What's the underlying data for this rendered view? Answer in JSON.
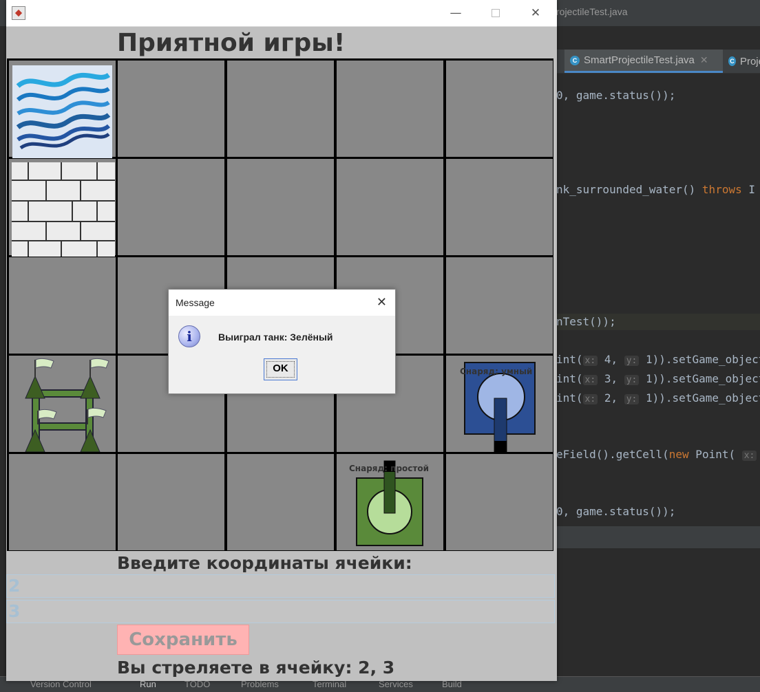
{
  "ide": {
    "window_title": "rojectileTest.java",
    "tabs": [
      {
        "label": "SmartProjectileTest.java",
        "active": true,
        "icon": "class-icon"
      },
      {
        "label": "Proje",
        "active": false,
        "icon": "class-icon"
      }
    ],
    "code": [
      {
        "parts": [
          {
            "t": "0, game.status());",
            "c": "plain"
          }
        ]
      },
      {
        "parts": [
          {
            "t": "nk_surrounded_water() ",
            "c": "plain"
          },
          {
            "t": "throws",
            "c": "kw"
          },
          {
            "t": " I",
            "c": "plain"
          }
        ]
      },
      {
        "parts": [
          {
            "t": "nTest());",
            "c": "plain"
          }
        ]
      },
      {
        "parts": [
          {
            "t": "int(",
            "c": "plain"
          },
          {
            "t": "x:",
            "c": "hint"
          },
          {
            "t": " 4, ",
            "c": "plain"
          },
          {
            "t": "y:",
            "c": "hint"
          },
          {
            "t": " 1)).setGame_object",
            "c": "plain"
          }
        ]
      },
      {
        "parts": [
          {
            "t": "int(",
            "c": "plain"
          },
          {
            "t": "x:",
            "c": "hint"
          },
          {
            "t": " 3, ",
            "c": "plain"
          },
          {
            "t": "y:",
            "c": "hint"
          },
          {
            "t": " 1)).setGame_object",
            "c": "plain"
          }
        ]
      },
      {
        "parts": [
          {
            "t": "int(",
            "c": "plain"
          },
          {
            "t": "x:",
            "c": "hint"
          },
          {
            "t": " 2, ",
            "c": "plain"
          },
          {
            "t": "y:",
            "c": "hint"
          },
          {
            "t": " 1)).setGame_object",
            "c": "plain"
          }
        ]
      },
      {
        "parts": [
          {
            "t": "eField().getCell(",
            "c": "plain"
          },
          {
            "t": "new",
            "c": "kw"
          },
          {
            "t": " Point( ",
            "c": "plain"
          },
          {
            "t": "x:",
            "c": "hint"
          }
        ]
      },
      {
        "parts": [
          {
            "t": "0, game.status());",
            "c": "plain"
          }
        ]
      }
    ],
    "status_bar": [
      "Version Control",
      "Run",
      "TODO",
      "Problems",
      "Terminal",
      "Services",
      "Build"
    ]
  },
  "game": {
    "title": "Приятной игры!",
    "window_controls": [
      "minimize",
      "maximize",
      "close"
    ],
    "cells": {
      "water": {
        "col": 0,
        "row": 0,
        "type": "water"
      },
      "wall": {
        "col": 0,
        "row": 1,
        "type": "wall"
      },
      "headquarters": {
        "col": 0,
        "row": 3,
        "type": "headquarters"
      },
      "blue_tank": {
        "col": 4,
        "row": 3,
        "label": "Снаряд: умный",
        "color": "#2c4f94"
      },
      "green_tank": {
        "col": 3,
        "row": 4,
        "label": "Снаряд: простой",
        "color": "#5a8a3a"
      }
    },
    "coords_prompt": "Введите координаты ячейки:",
    "input_x": "2",
    "input_y": "3",
    "save_label": "Сохранить",
    "shot_text": "Вы стреляете в ячейку: 2, 3"
  },
  "dialog": {
    "title": "Message",
    "message": "Выиграл танк: Зелёный",
    "ok_label": "OK"
  }
}
